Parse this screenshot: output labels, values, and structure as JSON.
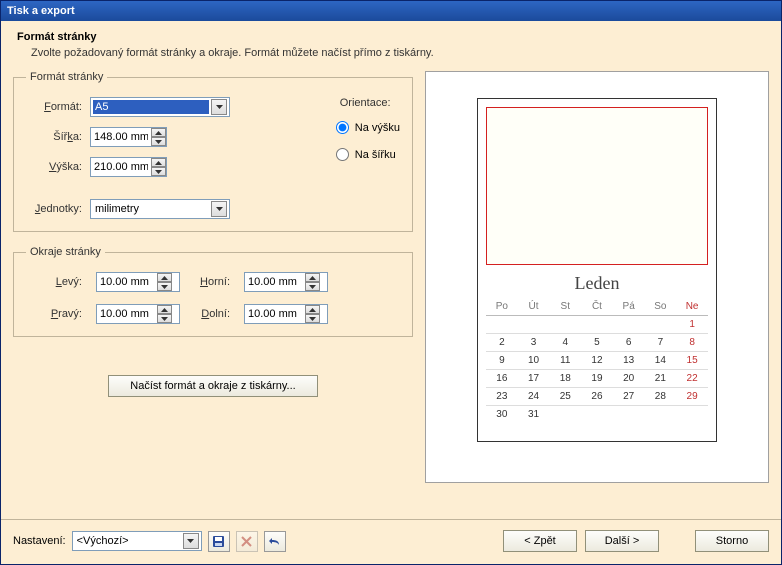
{
  "window": {
    "title": "Tisk a export"
  },
  "header": {
    "title": "Formát stránky",
    "desc": "Zvolte požadovaný formát stránky a okraje. Formát můžete načíst přímo z tiskárny."
  },
  "page_format": {
    "legend": "Formát stránky",
    "format_label": "Formát:",
    "format_value": "A5",
    "width_label": "Šířka:",
    "width_value": "148.00 mm",
    "height_label": "Výška:",
    "height_value": "210.00 mm",
    "units_label": "Jednotky:",
    "units_value": "milimetry",
    "orientation_label": "Orientace:",
    "portrait_label": "Na výšku",
    "landscape_label": "Na šířku",
    "portrait_checked": true
  },
  "margins": {
    "legend": "Okraje stránky",
    "left_label": "Levý:",
    "left_value": "10.00 mm",
    "right_label": "Pravý:",
    "right_value": "10.00 mm",
    "top_label": "Horní:",
    "top_value": "10.00 mm",
    "bottom_label": "Dolní:",
    "bottom_value": "10.00 mm"
  },
  "load_button": "Načíst formát a okraje z tiskárny...",
  "footer": {
    "settings_label": "Nastavení:",
    "settings_value": "<Výchozí>",
    "back": "< Zpět",
    "next": "Další >",
    "cancel": "Storno"
  },
  "preview": {
    "month": "Leden",
    "weekdays": [
      "Po",
      "Út",
      "St",
      "Čt",
      "Pá",
      "So",
      "Ne"
    ],
    "weeks": [
      [
        "",
        "",
        "",
        "",
        "",
        "",
        "1"
      ],
      [
        "2",
        "3",
        "4",
        "5",
        "6",
        "7",
        "8"
      ],
      [
        "9",
        "10",
        "11",
        "12",
        "13",
        "14",
        "15"
      ],
      [
        "16",
        "17",
        "18",
        "19",
        "20",
        "21",
        "22"
      ],
      [
        "23",
        "24",
        "25",
        "26",
        "27",
        "28",
        "29"
      ],
      [
        "30",
        "31",
        "",
        "",
        "",
        "",
        ""
      ]
    ]
  }
}
